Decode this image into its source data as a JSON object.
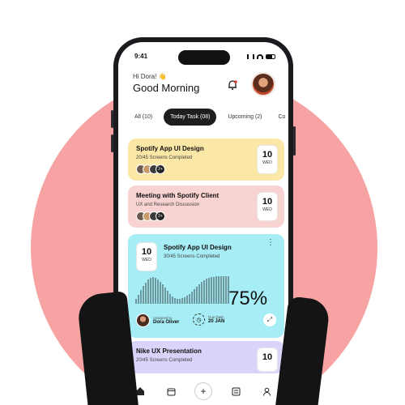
{
  "status": {
    "time": "9:41"
  },
  "header": {
    "greeting": "Hi Dora! 👋",
    "title": "Good Morning"
  },
  "tabs": [
    {
      "label": "All (10)",
      "active": false
    },
    {
      "label": "Today Task (08)",
      "active": true
    },
    {
      "label": "Upcoming (2)",
      "active": false
    },
    {
      "label": "Co",
      "active": false
    }
  ],
  "cards": [
    {
      "title": "Spotify App UI Design",
      "subtitle": "20/45 Screens Completed",
      "day": "10",
      "weekday": "WED",
      "more": "2+",
      "color": "#fbe7a6"
    },
    {
      "title": "Meeting with Spotify Client",
      "subtitle": "UX and Research Discussion",
      "day": "10",
      "weekday": "WED",
      "more": "2+",
      "color": "#f9d2d2"
    },
    {
      "title": "Spotify App UI Design",
      "subtitle": "30/45 Screens Completed",
      "day": "10",
      "weekday": "WED",
      "progress": "75%",
      "assigned_label": "Assigned to",
      "assigned_name": "Dora Oliver",
      "due_label": "Due Date",
      "due_date": "20 JAN",
      "color": "#a6edf5"
    },
    {
      "title": "Nike UX Presentation",
      "subtitle": "20/45 Screens Completed",
      "day": "10",
      "color": "#dcd3fa"
    }
  ],
  "nav": [
    "home-icon",
    "calendar-icon",
    "add-icon",
    "list-icon",
    "profile-icon"
  ],
  "colors": {
    "background_circle": "#f7a3a3",
    "active_tab": "#1e1e1e"
  }
}
